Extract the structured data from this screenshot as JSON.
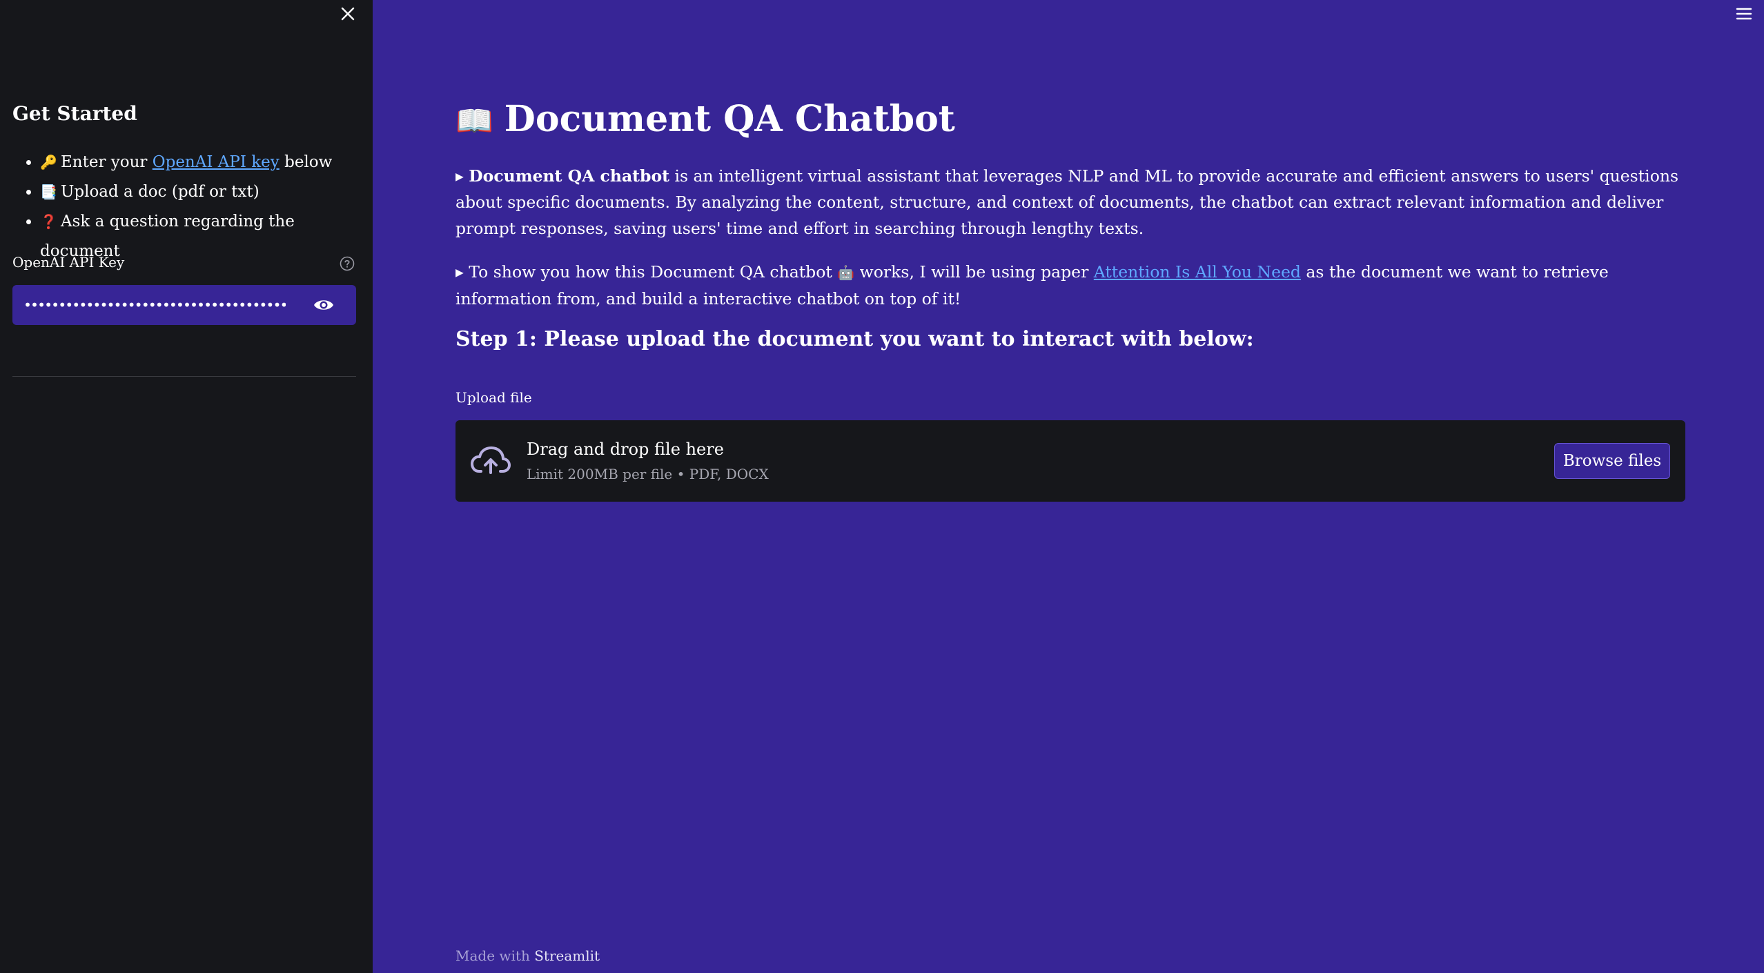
{
  "sidebar": {
    "title": "Get Started",
    "steps": [
      {
        "icon": "key-icon",
        "emoji": "🔑",
        "prefix": "Enter your ",
        "link": "OpenAI API key",
        "suffix": " below"
      },
      {
        "icon": "bookmark-tabs-icon",
        "emoji": "📑",
        "text": "Upload a doc (pdf or txt)"
      },
      {
        "icon": "question-mark-icon",
        "emoji": "❓",
        "text": "Ask a question regarding the document"
      }
    ],
    "api_key_label": "OpenAI API Key",
    "api_key_value": "••••••••••••••••••••••••••••••••••••••••••••••••••••"
  },
  "main": {
    "title_emoji": "📖",
    "title": "Document QA Chatbot",
    "para1": {
      "marker": "▸ ",
      "bold": "Document QA chatbot",
      "text": " is an intelligent virtual assistant that leverages NLP and ML to provide accurate and efficient answers to users' questions about specific documents. By analyzing the content, structure, and context of documents, the chatbot can extract relevant information and deliver prompt responses, saving users' time and effort in searching through lengthy texts."
    },
    "para2": {
      "marker": "▸ ",
      "text_before": "To show you how this Document QA chatbot ",
      "robot_emoji": "🤖",
      "text_middle": " works, I will be using paper ",
      "link": "Attention Is All You Need",
      "text_after": " as the document we want to retrieve information from, and build a interactive chatbot on top of it!"
    },
    "step_heading": "Step 1: Please upload the document you want to interact with below:",
    "upload": {
      "label": "Upload file",
      "title": "Drag and drop file here",
      "subtitle": "Limit 200MB per file • PDF, DOCX",
      "button": "Browse files"
    },
    "footer": {
      "prefix": "Made with ",
      "brand": "Streamlit"
    }
  },
  "colors": {
    "main_bg": "#372596",
    "sidebar_bg": "#16171b",
    "link": "#5fa8ff"
  }
}
